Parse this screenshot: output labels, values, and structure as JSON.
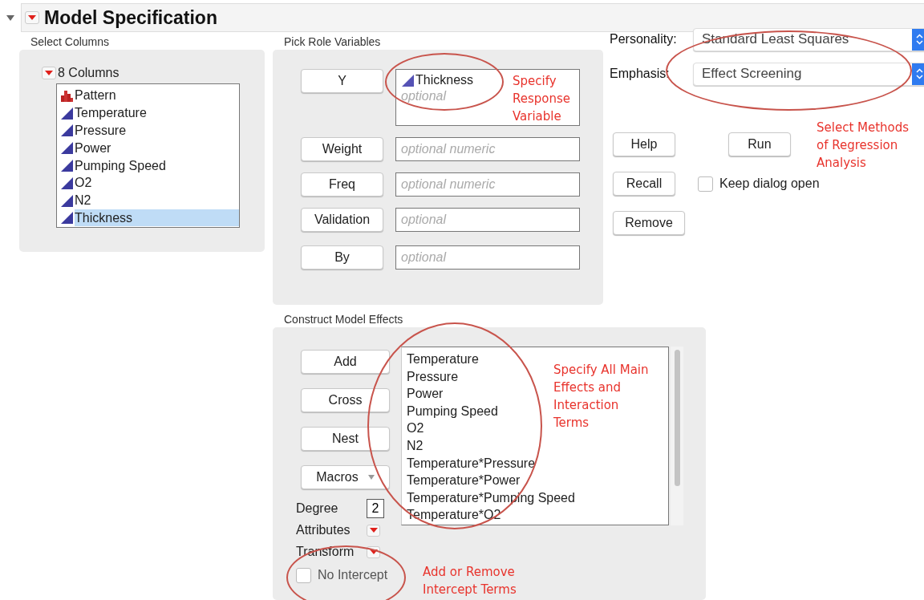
{
  "header": {
    "title": "Model Specification",
    "expanded": true
  },
  "select_columns": {
    "label": "Select Columns",
    "group": "8 Columns",
    "columns": [
      {
        "name": "Pattern",
        "kind": "nominal",
        "selected": false
      },
      {
        "name": "Temperature",
        "kind": "continuous",
        "selected": false
      },
      {
        "name": "Pressure",
        "kind": "continuous",
        "selected": false
      },
      {
        "name": "Power",
        "kind": "continuous",
        "selected": false
      },
      {
        "name": "Pumping Speed",
        "kind": "continuous",
        "selected": false
      },
      {
        "name": "O2",
        "kind": "continuous",
        "selected": false
      },
      {
        "name": "N2",
        "kind": "continuous",
        "selected": false
      },
      {
        "name": "Thickness",
        "kind": "continuous",
        "selected": true
      }
    ]
  },
  "pick_role": {
    "label": "Pick Role Variables",
    "roles": [
      {
        "button": "Y",
        "kind": "list",
        "items": [
          {
            "name": "Thickness",
            "kind": "continuous"
          }
        ],
        "placeholder": "optional"
      },
      {
        "button": "Weight",
        "kind": "field",
        "placeholder": "optional numeric"
      },
      {
        "button": "Freq",
        "kind": "field",
        "placeholder": "optional numeric"
      },
      {
        "button": "Validation",
        "kind": "field",
        "placeholder": "optional"
      },
      {
        "button": "By",
        "kind": "field",
        "placeholder": "optional"
      }
    ]
  },
  "personality": {
    "label": "Personality:",
    "value": "Standard Least Squares"
  },
  "emphasis": {
    "label": "Emphasis:",
    "value": "Effect Screening"
  },
  "help_button": "Help",
  "run_button": "Run",
  "recall_button": "Recall",
  "remove_button": "Remove",
  "keep_open": {
    "label": "Keep dialog open",
    "checked": false
  },
  "construct": {
    "label": "Construct Model Effects",
    "buttons": [
      {
        "label": "Add",
        "kind": "plain"
      },
      {
        "label": "Cross",
        "kind": "plain"
      },
      {
        "label": "Nest",
        "kind": "plain"
      },
      {
        "label": "Macros",
        "kind": "menu"
      }
    ],
    "degree": {
      "label": "Degree",
      "value": "2"
    },
    "menus": [
      "Attributes",
      "Transform"
    ],
    "no_intercept": {
      "label": "No Intercept",
      "checked": false
    },
    "effects": [
      "Temperature",
      "Pressure",
      "Power",
      "Pumping Speed",
      "O2",
      "N2",
      "Temperature*Pressure",
      "Temperature*Power",
      "Temperature*Pumping Speed",
      "Temperature*O2"
    ]
  },
  "annotations": [
    {
      "text": "Specify\nResponse\nVariable"
    },
    {
      "text": "Select Methods\nof Regression\nAnalysis"
    },
    {
      "text": "Specify All Main\nEffects and\nInteraction\nTerms"
    },
    {
      "text": "Add or Remove\nIntercept Terms"
    }
  ]
}
